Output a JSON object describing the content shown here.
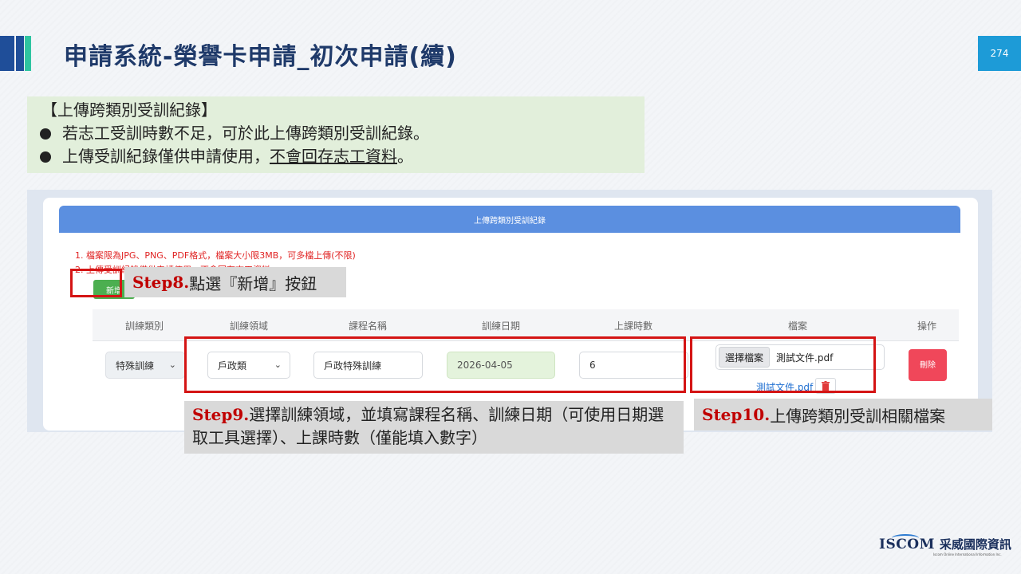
{
  "slide": {
    "title": "申請系統-榮譽卡申請_初次申請(續)",
    "page_number": "274"
  },
  "note": {
    "heading": "【上傳跨類別受訓紀錄】",
    "bullet1": "若志工受訓時數不足，可於此上傳跨類別受訓紀錄。",
    "bullet2_prefix": "上傳受訓紀錄僅供申請使用，",
    "bullet2_underlined": "不會回存志工資料",
    "bullet2_suffix": "。"
  },
  "screen": {
    "card_title": "上傳跨類別受訓紀錄",
    "red_notes": [
      "1. 檔案限為JPG、PNG、PDF格式，檔案大小限3MB，可多檔上傳(不限)",
      "2. 上傳受訓紀錄僅供申請使用，不會回存志工資料。"
    ],
    "add_button": "新增",
    "columns": [
      "訓練類別",
      "訓練領域",
      "課程名稱",
      "訓練日期",
      "上課時數",
      "檔案",
      "操作"
    ],
    "row": {
      "category": "特殊訓練",
      "domain": "戶政類",
      "course": "戶政特殊訓練",
      "date": "2026-04-05",
      "hours": "6",
      "file_button": "選擇檔案",
      "file_name": "測試文件.pdf",
      "file_link": "測試文件.pdf",
      "delete_button": "刪除"
    }
  },
  "steps": {
    "step8_label": "Step8.",
    "step8_text": "點選『新增』按鈕",
    "step9_label": "Step9.",
    "step9_text": "選擇訓練領域，並填寫課程名稱、訓練日期（可使用日期選取工具選擇）、上課時數（僅能填入數字）",
    "step10_label": "Step10.",
    "step10_text": "上傳跨類別受訓相關檔案"
  },
  "footer": {
    "logo_text": "ISCOM",
    "logo_cn": "采威國際資訊",
    "logo_sub": "Iscom Online International Information Inc."
  },
  "colors": {
    "highlight_red": "#d41414",
    "step_label_red": "#c00000",
    "card_header_blue": "#5b8fe0",
    "add_green": "#4caf50",
    "delete_red": "#f0475a",
    "title_navy": "#1f3a6a"
  }
}
